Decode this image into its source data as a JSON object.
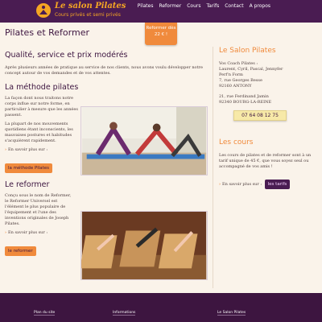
{
  "header": {
    "logo_title": "Le salon Pilates",
    "logo_subtitle": "Cours privés et semi privés",
    "nav": [
      "Pilates",
      "Reformer",
      "Cours",
      "Tarifs",
      "Contact",
      "A propos"
    ]
  },
  "ribbon": {
    "line1": "Reformer dès",
    "line2": "22 € !"
  },
  "main": {
    "title": "Pilates et Reformer",
    "quality_title": "Qualité, service et prix modérés",
    "quality_text": "Après plusieurs années de pratique au service de nos clients, nous avons voulu développer notre concept autour de vos demandes et de vos attentes.",
    "method": {
      "title": "La méthode pilates",
      "para1": "La façon dont nous traitons notre corps influe sur notre forme, en particulier à mesure que les années passent.",
      "para2": "La plupart de nos mouvements quotidiens étant inconscients, les mauvaises postures et habitudes s'acquièrent rapidement.",
      "more": "En savoir plus sur :",
      "button": "la méthode Pilates"
    },
    "reformer": {
      "title": "Le reformer",
      "para": "Conçu sous le nom de Reformer, le Reformer Universel est l'élément le plus populaire de l'équipement et l'une des inventions originales de Joseph Pilates.",
      "more": "En savoir plus sur :",
      "button": "le reformer"
    }
  },
  "side": {
    "title": "Le Salon Pilates",
    "address_lines": [
      "Vos Coach Pilates :",
      "Laurent, Cyril, Pascal, Jennyfer",
      "Perf'n Form",
      "7, rue Georges Besse",
      "92160 ANTONY"
    ],
    "address2_lines": [
      "21, rue Ferdinand Jamin",
      "92340 BOURG-LA-REINE"
    ],
    "phone": "07 64 08 12 75",
    "courses_title": "Les cours",
    "courses_text": "Les cours de pilates et de reformer sont à un tarif unique de 45 €, que vous soyez seul ou accompagné de vos amis !",
    "courses_more": "En savoir plus sur :",
    "courses_button": "les tarifs"
  },
  "footer": {
    "links": [
      "Plan du site",
      "Informations",
      "Le Salon Pilates"
    ]
  },
  "colors": {
    "purple": "#4a1c52",
    "orange": "#f08a3c",
    "cream": "#faf3ea"
  }
}
